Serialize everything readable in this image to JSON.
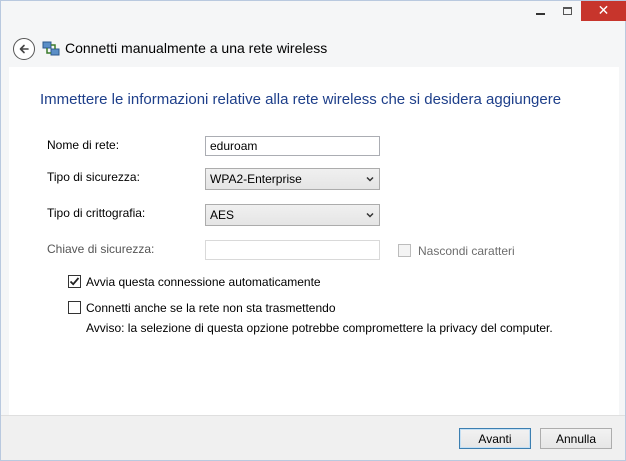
{
  "window": {
    "controls": {
      "minimize_icon": "minimize-icon",
      "maximize_icon": "maximize-icon",
      "close_icon": "close-icon",
      "close_color": "#c7352c"
    }
  },
  "header": {
    "title": "Connetti manualmente a una rete wireless",
    "back_icon": "back-arrow-icon",
    "network_icon": "network-icon"
  },
  "main": {
    "instruction": "Immettere le informazioni relative alla rete wireless che si desidera aggiungere",
    "instruction_color": "#1e3f8a",
    "network_name": {
      "label": "Nome di rete:",
      "value": "eduroam"
    },
    "security_type": {
      "label": "Tipo di sicurezza:",
      "selected": "WPA2-Enterprise"
    },
    "encryption_type": {
      "label": "Tipo di crittografia:",
      "selected": "AES"
    },
    "security_key": {
      "label": "Chiave di sicurezza:",
      "value": "",
      "enabled": false,
      "hide_chars": {
        "label": "Nascondi caratteri",
        "checked": false,
        "enabled": false
      }
    },
    "auto_start": {
      "label": "Avvia questa connessione automaticamente",
      "checked": true
    },
    "connect_hidden": {
      "label": "Connetti anche se la rete non sta trasmettendo",
      "checked": false,
      "warning": "Avviso: la selezione di questa opzione potrebbe compromettere la privacy del computer."
    }
  },
  "footer": {
    "next_label": "Avanti",
    "cancel_label": "Annulla"
  }
}
